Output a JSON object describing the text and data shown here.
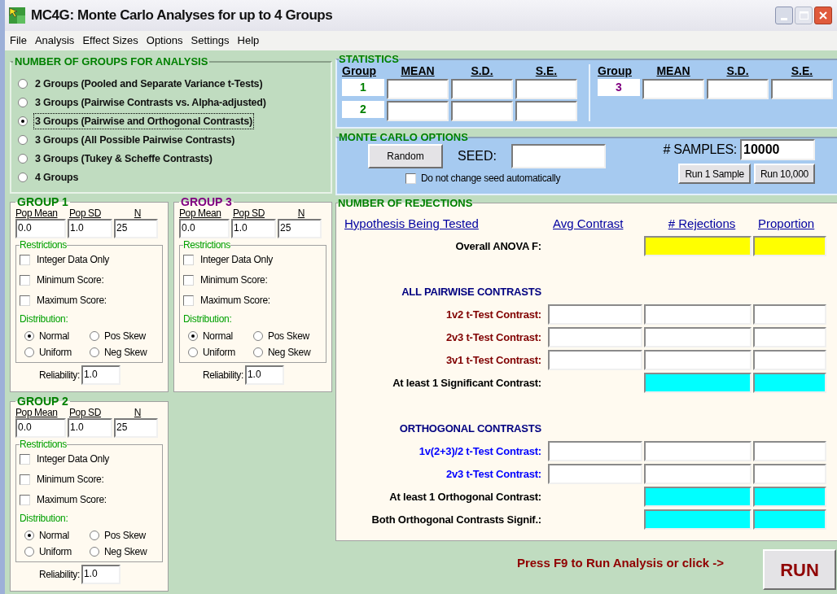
{
  "window": {
    "title": "MC4G: Monte Carlo Analyses for up to 4 Groups"
  },
  "menu": [
    "File",
    "Analysis",
    "Effect Sizes",
    "Options",
    "Settings",
    "Help"
  ],
  "groups_panel": {
    "title": "NUMBER OF GROUPS FOR ANALYSIS",
    "options": [
      {
        "label": "2 Groups (Pooled and Separate Variance t-Tests)",
        "selected": false
      },
      {
        "label": "3 Groups (Pairwise Contrasts vs. Alpha-adjusted)",
        "selected": false
      },
      {
        "label": "3 Groups (Pairwise and Orthogonal Contrasts)",
        "selected": true
      },
      {
        "label": "3 Groups (All Possible Pairwise Contrasts)",
        "selected": false
      },
      {
        "label": "3 Groups (Tukey & Scheffe Contrasts)",
        "selected": false
      },
      {
        "label": "4 Groups",
        "selected": false
      }
    ]
  },
  "statistics": {
    "title": "STATISTICS",
    "tables": [
      {
        "columns": [
          "Group",
          "MEAN",
          "S.D.",
          "S.E."
        ],
        "rows": [
          {
            "group": "1",
            "color": "#008000"
          },
          {
            "group": "2",
            "color": "#008000"
          }
        ]
      },
      {
        "columns": [
          "Group",
          "MEAN",
          "S.D.",
          "S.E."
        ],
        "rows": [
          {
            "group": "3",
            "color": "#800080"
          }
        ]
      }
    ]
  },
  "monte_carlo": {
    "title": "MONTE CARLO OPTIONS",
    "random_button": "Random",
    "seed_label": "SEED:",
    "keep_seed": {
      "label": "Do not change seed automatically",
      "checked": false
    },
    "samples_label": "# SAMPLES:",
    "samples": "10000",
    "buttons": [
      "Run 1 Sample",
      "Run 10,000"
    ]
  },
  "group_cards": [
    {
      "title": "GROUP 1",
      "color": "#008000",
      "columns": [
        "Pop Mean",
        "Pop SD",
        "N"
      ],
      "values": [
        "0.0",
        "1.0",
        "25"
      ],
      "restrictions_title": "Restrictions",
      "restrictions": [
        {
          "label": "Integer Data Only",
          "checked": false
        },
        {
          "label": "Minimum Score:",
          "checked": false
        },
        {
          "label": "Maximum Score:",
          "checked": false
        }
      ],
      "distribution_title": "Distribution:",
      "distributions": [
        {
          "label": "Normal",
          "selected": true
        },
        {
          "label": "Pos Skew",
          "selected": false
        },
        {
          "label": "Uniform",
          "selected": false
        },
        {
          "label": "Neg Skew",
          "selected": false
        }
      ],
      "reliability_label": "Reliability:",
      "reliability": "1.0"
    },
    {
      "title": "GROUP 3",
      "color": "#800080",
      "columns": [
        "Pop Mean",
        "Pop SD",
        "N"
      ],
      "values": [
        "0.0",
        "1.0",
        "25"
      ],
      "restrictions_title": "Restrictions",
      "restrictions": [
        {
          "label": "Integer Data Only",
          "checked": false
        },
        {
          "label": "Minimum Score:",
          "checked": false
        },
        {
          "label": "Maximum Score:",
          "checked": false
        }
      ],
      "distribution_title": "Distribution:",
      "distributions": [
        {
          "label": "Normal",
          "selected": true
        },
        {
          "label": "Pos Skew",
          "selected": false
        },
        {
          "label": "Uniform",
          "selected": false
        },
        {
          "label": "Neg Skew",
          "selected": false
        }
      ],
      "reliability_label": "Reliability:",
      "reliability": "1.0"
    },
    {
      "title": "GROUP 2",
      "color": "#008000",
      "columns": [
        "Pop Mean",
        "Pop SD",
        "N"
      ],
      "values": [
        "0.0",
        "1.0",
        "25"
      ],
      "restrictions_title": "Restrictions",
      "restrictions": [
        {
          "label": "Integer Data Only",
          "checked": false
        },
        {
          "label": "Minimum Score:",
          "checked": false
        },
        {
          "label": "Maximum Score:",
          "checked": false
        }
      ],
      "distribution_title": "Distribution:",
      "distributions": [
        {
          "label": "Normal",
          "selected": true
        },
        {
          "label": "Pos Skew",
          "selected": false
        },
        {
          "label": "Uniform",
          "selected": false
        },
        {
          "label": "Neg Skew",
          "selected": false
        }
      ],
      "reliability_label": "Reliability:",
      "reliability": "1.0"
    }
  ],
  "rejections": {
    "title": "NUMBER OF REJECTIONS",
    "columns": [
      "Hypothesis Being Tested",
      "Avg Contrast",
      "# Rejections",
      "Proportion"
    ],
    "rows": [
      {
        "kind": "overall",
        "label": "Overall ANOVA F:",
        "color": "#000000"
      },
      {
        "kind": "section",
        "label": "ALL PAIRWISE CONTRASTS",
        "color": "#000080"
      },
      {
        "kind": "contrast",
        "label": "1v2 t-Test Contrast:",
        "color": "#800000"
      },
      {
        "kind": "contrast",
        "label": "2v3 t-Test Contrast:",
        "color": "#800000"
      },
      {
        "kind": "contrast",
        "label": "3v1 t-Test Contrast:",
        "color": "#800000"
      },
      {
        "kind": "summary",
        "label": "At least 1 Significant Contrast:",
        "color": "#000000"
      },
      {
        "kind": "section",
        "label": "ORTHOGONAL CONTRASTS",
        "color": "#000080"
      },
      {
        "kind": "contrast",
        "label": "1v(2+3)/2 t-Test Contrast:",
        "color": "#0000ff"
      },
      {
        "kind": "contrast",
        "label": "2v3 t-Test Contrast:",
        "color": "#0000ff"
      },
      {
        "kind": "summary",
        "label": "At least 1 Orthogonal Contrast:",
        "color": "#000000"
      },
      {
        "kind": "summary",
        "label": "Both Orthogonal Contrasts Signif.:",
        "color": "#000000"
      }
    ]
  },
  "footer": {
    "prompt": "Press F9 to Run Analysis or click ->",
    "run_button": "RUN"
  }
}
